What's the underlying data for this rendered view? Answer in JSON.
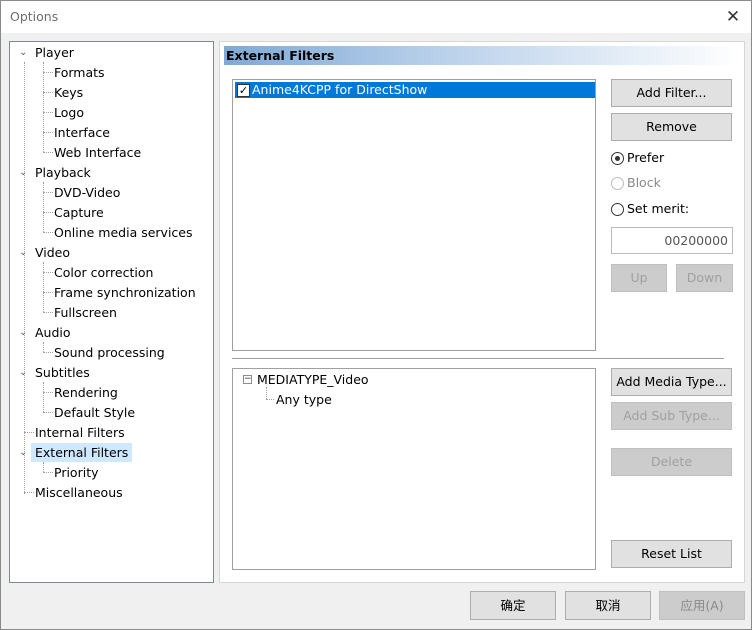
{
  "window": {
    "title": "Options"
  },
  "tree": {
    "items": [
      {
        "label": "Player"
      },
      {
        "label": "Formats"
      },
      {
        "label": "Keys"
      },
      {
        "label": "Logo"
      },
      {
        "label": "Interface"
      },
      {
        "label": "Web Interface"
      },
      {
        "label": "Playback"
      },
      {
        "label": "DVD-Video"
      },
      {
        "label": "Capture"
      },
      {
        "label": "Online media services"
      },
      {
        "label": "Video"
      },
      {
        "label": "Color correction"
      },
      {
        "label": "Frame synchronization"
      },
      {
        "label": "Fullscreen"
      },
      {
        "label": "Audio"
      },
      {
        "label": "Sound processing"
      },
      {
        "label": "Subtitles"
      },
      {
        "label": "Rendering"
      },
      {
        "label": "Default Style"
      },
      {
        "label": "Internal Filters"
      },
      {
        "label": "External Filters"
      },
      {
        "label": "Priority"
      },
      {
        "label": "Miscellaneous"
      }
    ],
    "selected": "External Filters"
  },
  "panel": {
    "header": "External Filters",
    "filters": [
      {
        "label": "Anime4KCPP for DirectShow",
        "checked": true
      }
    ],
    "buttons": {
      "add_filter": "Add Filter...",
      "remove": "Remove",
      "up": "Up",
      "down": "Down",
      "add_media_type": "Add Media Type...",
      "add_sub_type": "Add Sub Type...",
      "delete": "Delete",
      "reset_list": "Reset List"
    },
    "radios": {
      "prefer": "Prefer",
      "block": "Block",
      "set_merit": "Set merit:",
      "selected": "prefer"
    },
    "merit_value": "00200000",
    "media_types": {
      "root": "MEDIATYPE_Video",
      "child": "Any type"
    }
  },
  "footer": {
    "ok": "确定",
    "cancel": "取消",
    "apply": "应用(A)"
  }
}
